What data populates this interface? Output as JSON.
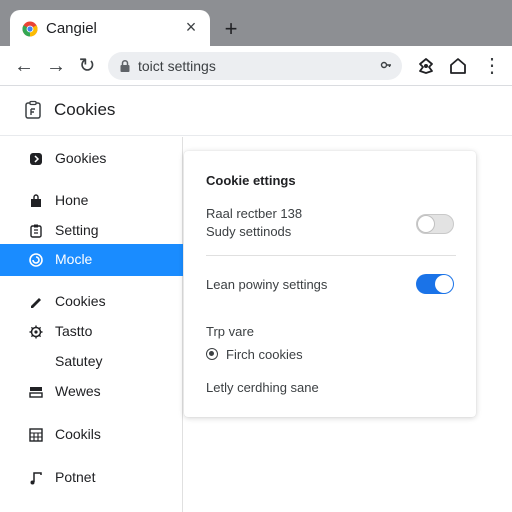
{
  "tab": {
    "title": "Cangiel",
    "close": "×"
  },
  "new_tab": "+",
  "toolbar": {
    "back": "←",
    "forward": "→",
    "reload": "↻",
    "url": "toict settings",
    "omni_key_icon": "key-icon",
    "menu": "⋮"
  },
  "page": {
    "title": "Cookies"
  },
  "sidebar": {
    "items": [
      {
        "label": "Gookies",
        "icon": "shield-icon"
      },
      {
        "label": "Hone",
        "icon": "bag-icon"
      },
      {
        "label": "Setting",
        "icon": "clipboard-icon"
      },
      {
        "label": "Mocle",
        "icon": "spiral-icon",
        "active": true
      },
      {
        "label": "Cookies",
        "icon": "pencil-icon"
      },
      {
        "label": "Tastto",
        "icon": "gear-icon"
      },
      {
        "label": "Satutey",
        "icon": ""
      },
      {
        "label": "Wewes",
        "icon": "layers-icon"
      },
      {
        "label": "Cookils",
        "icon": "grid-icon"
      },
      {
        "label": "Potnet",
        "icon": "music-icon"
      }
    ]
  },
  "card": {
    "title": "Cookie ettings",
    "setting1_line1": "Raal rectber 138",
    "setting1_line2": "Sudy settinods",
    "setting1_on": false,
    "setting2_label": "Lean powiny settings",
    "setting2_on": true,
    "section_label": "Trp vare",
    "radio_label": "Firch cookies",
    "footer_text": "Letly cerdhing sane"
  },
  "colors": {
    "accent": "#1a8cff",
    "toggle_on": "#1a73e8",
    "tabstrip": "#8d8f93"
  }
}
